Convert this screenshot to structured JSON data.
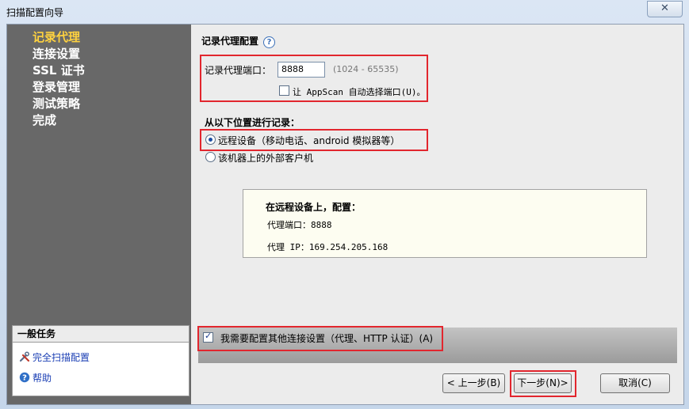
{
  "window": {
    "title": "扫描配置向导",
    "close_glyph": "✕"
  },
  "sidebar": {
    "nav": [
      {
        "label": "记录代理",
        "active": true
      },
      {
        "label": "连接设置",
        "active": false
      },
      {
        "label": "SSL 证书",
        "active": false
      },
      {
        "label": "登录管理",
        "active": false
      },
      {
        "label": "测试策略",
        "active": false
      },
      {
        "label": "完成",
        "active": false
      }
    ],
    "tasks": {
      "title": "一般任务",
      "items": [
        {
          "label": "完全扫描配置",
          "icon": "tools-icon"
        },
        {
          "label": "帮助",
          "icon": "help-icon"
        }
      ]
    }
  },
  "main": {
    "section_title": "记录代理配置",
    "help_glyph": "?",
    "port": {
      "label": "记录代理端口：",
      "value": "8888",
      "range": "(1024 - 65535)"
    },
    "auto_port": {
      "label": "让 AppScan 自动选择端口(U)。",
      "checked": false
    },
    "record_from": {
      "title": "从以下位置进行记录：",
      "options": [
        {
          "label": "远程设备（移动电话、android 模拟器等）",
          "selected": true
        },
        {
          "label": "该机器上的外部客户机",
          "selected": false
        }
      ]
    },
    "info_box": {
      "title": "在远程设备上，配置：",
      "port_line": "代理端口：8888",
      "ip_line": "代理 IP：169.254.205.168"
    },
    "extra_settings": {
      "label": "我需要配置其他连接设置（代理、HTTP 认证）(A)",
      "checked": true
    },
    "buttons": {
      "back": "< 上一步(B)",
      "next": "下一步(N)>",
      "cancel": "取消(C)"
    }
  },
  "colors": {
    "accent_red": "#e2262e",
    "active_nav": "#ffd23f",
    "sidebar_bg": "#686868"
  }
}
